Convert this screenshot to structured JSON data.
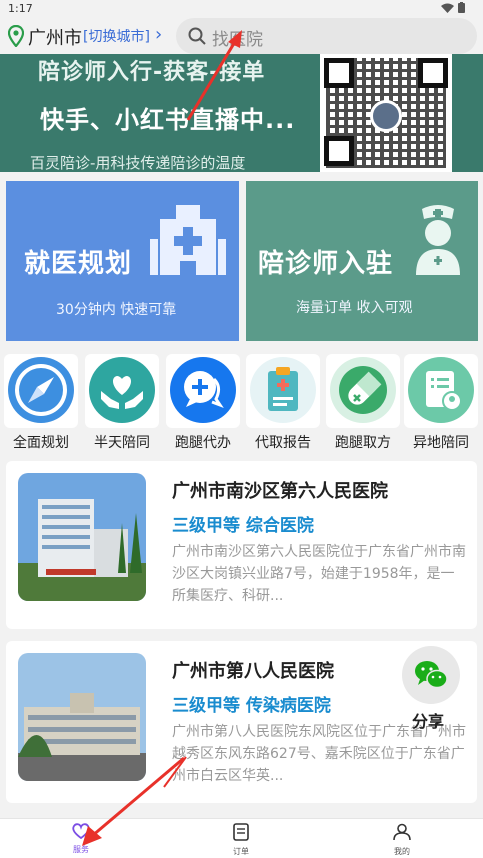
{
  "status": {
    "time": "1:17"
  },
  "header": {
    "city": "广州市",
    "switch_label": "[切换城市]",
    "chevron": "›",
    "search_placeholder": "找医院"
  },
  "banner": {
    "line1": "陪诊师入行-获客-接单",
    "line2": "快手、小红书直播中...",
    "line3": "百灵陪诊-用科技传递陪诊的温度"
  },
  "cards": [
    {
      "title": "就医规划",
      "subtitle": "30分钟内 快速可靠",
      "icon": "hospital-icon",
      "color": "#5b8fe0"
    },
    {
      "title": "陪诊师入驻",
      "subtitle": "海量订单 收入可观",
      "icon": "nurse-icon",
      "color": "#5b9b8a"
    }
  ],
  "services": [
    {
      "label": "全面规划",
      "icon": "compass-icon"
    },
    {
      "label": "半天陪同",
      "icon": "heart-hands-icon"
    },
    {
      "label": "跑腿代办",
      "icon": "chat-plus-icon"
    },
    {
      "label": "代取报告",
      "icon": "clipboard-icon"
    },
    {
      "label": "跑腿取方",
      "icon": "pill-icon"
    },
    {
      "label": "异地陪同",
      "icon": "document-user-icon"
    }
  ],
  "hospitals": [
    {
      "name": "广州市南沙区第六人民医院",
      "level": "三级甲等 综合医院",
      "desc": "广州市南沙区第六人民医院位于广东省广州市南沙区大岗镇兴业路7号，始建于1958年，是一所集医疗、科研..."
    },
    {
      "name": "广州市第八人民医院",
      "level": "三级甲等 传染病医院",
      "desc": "广州市第八人民医院东风院区位于广东省广州市越秀区东风东路627号、嘉禾院区位于广东省广州市白云区华英..."
    }
  ],
  "share": {
    "label": "分享",
    "icon": "wechat-icon"
  },
  "tabs": [
    {
      "label": "服务",
      "icon": "heart-icon",
      "active": true
    },
    {
      "label": "订单",
      "icon": "order-icon",
      "active": false
    },
    {
      "label": "我的",
      "icon": "user-icon",
      "active": false
    }
  ],
  "colors": {
    "accent": "#3a6cd6",
    "level": "#1a8ccf",
    "annotation": "#e8312a"
  }
}
